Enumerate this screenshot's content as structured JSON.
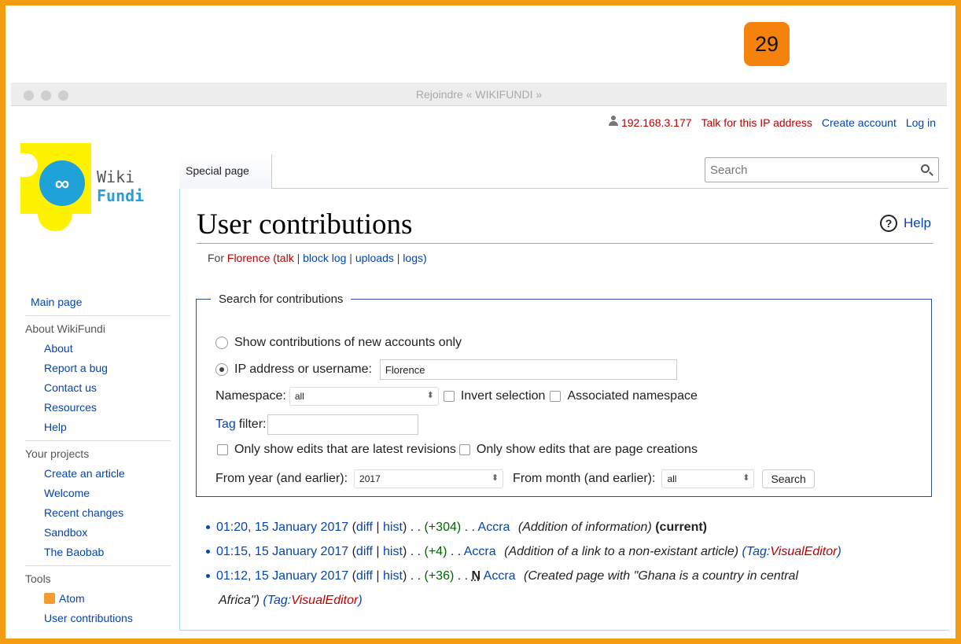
{
  "page_badge": "29",
  "window": {
    "title": "Rejoindre « WIKIFUNDI »"
  },
  "personal": {
    "ip": "192.168.3.177",
    "talk": "Talk for this IP address",
    "create": "Create account",
    "login": "Log in"
  },
  "logo": {
    "line1": "Wiki",
    "line2": "Fundi"
  },
  "sidebar": {
    "main_page": "Main page",
    "about_heading": "About WikiFundi",
    "about_items": [
      "About",
      "Report a bug",
      "Contact us",
      "Resources",
      "Help"
    ],
    "projects_heading": "Your projects",
    "project_items": [
      "Create an article",
      "Welcome",
      "Recent changes",
      "Sandbox",
      "The Baobab"
    ],
    "tools_heading": "Tools",
    "tool_items": [
      "Atom",
      "User contributions"
    ]
  },
  "tabs": {
    "special": "Special page"
  },
  "search": {
    "placeholder": "Search"
  },
  "page": {
    "title": "User contributions",
    "help": "Help",
    "subtitle": {
      "for": "For",
      "user": "Florence",
      "talk": "talk",
      "block_log": "block log",
      "uploads": "uploads",
      "logs": "logs"
    }
  },
  "form": {
    "legend": "Search for contributions",
    "radio_new": "Show contributions of new accounts only",
    "radio_ip": "IP address or username:",
    "username_value": "Florence",
    "namespace_label": "Namespace:",
    "namespace_value": "all",
    "invert": "Invert selection",
    "associated": "Associated namespace",
    "tag_link": "Tag",
    "tag_label": "filter:",
    "latest": "Only show edits that are latest revisions",
    "creations": "Only show edits that are page creations",
    "year_label": "From year (and earlier):",
    "year_value": "2017",
    "month_label": "From month (and earlier):",
    "month_value": "all",
    "search_button": "Search"
  },
  "results": [
    {
      "time": "01:20, 15 January 2017",
      "diff": "diff",
      "hist": "hist",
      "size": "(+304)",
      "page": "Accra",
      "summary": "(Addition of information)",
      "current": "(current)"
    },
    {
      "time": "01:15, 15 January 2017",
      "diff": "diff",
      "hist": "hist",
      "size": "(+4)",
      "page": "Accra",
      "summary": "(Addition of a link to a non-existant article)",
      "tag_prefix": "(Tag:",
      "tag": "VisualEditor",
      "tag_suffix": ")"
    },
    {
      "time": "01:12, 15 January 2017",
      "diff": "diff",
      "hist": "hist",
      "size": "(+36)",
      "new_flag": "N",
      "page": "Accra",
      "summary_line1": "(Created page with \"Ghana is a country in central",
      "summary_line2": "Africa\")",
      "tag_prefix": "(Tag:",
      "tag": "VisualEditor",
      "tag_suffix": ")"
    }
  ]
}
